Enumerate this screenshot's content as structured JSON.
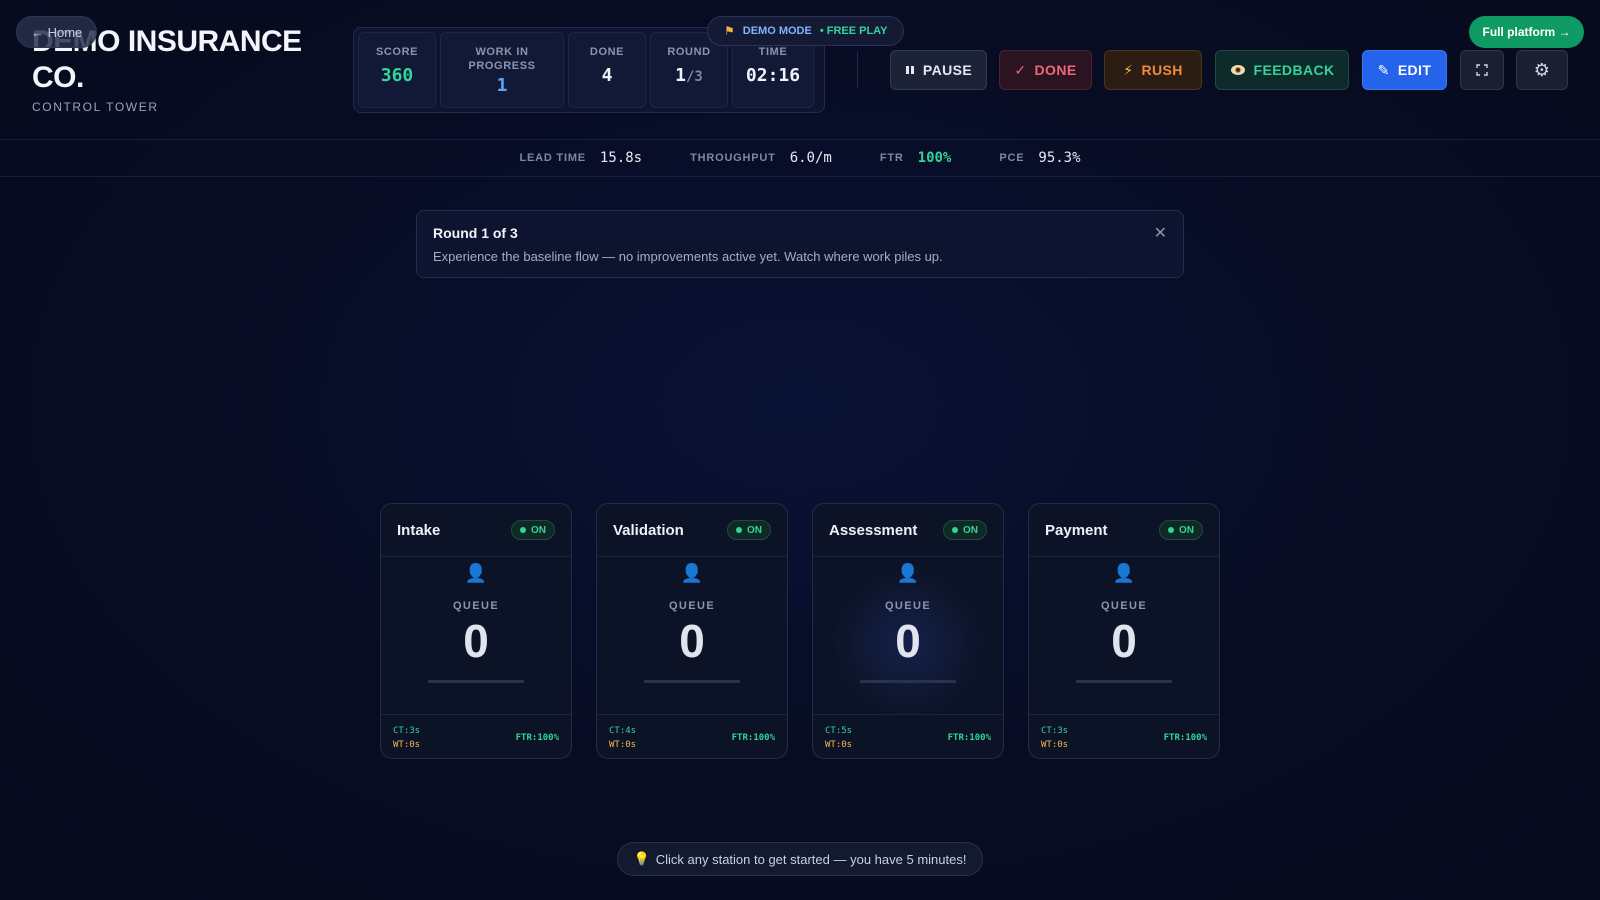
{
  "nav": {
    "home_label": "← Home"
  },
  "brand": {
    "title": "DEMO INSURANCE CO.",
    "subtitle": "CONTROL TOWER"
  },
  "demo_pill": {
    "mode": "DEMO MODE",
    "free": "• FREE PLAY"
  },
  "stats": {
    "score_label": "SCORE",
    "score": "360",
    "wip_label": "WORK IN PROGRESS",
    "wip": "1",
    "done_label": "DONE",
    "done": "4",
    "round_label": "ROUND",
    "round": "1",
    "round_total": "/3",
    "time_label": "TIME",
    "time": "02:16"
  },
  "toolbar": {
    "pause": "PAUSE",
    "done": "DONE",
    "rush": "RUSH",
    "feedback": "FEEDBACK",
    "edit": "EDIT",
    "full_platform": "Full platform →"
  },
  "metrics": [
    {
      "label": "LEAD TIME",
      "value": "15.8s"
    },
    {
      "label": "THROUGHPUT",
      "value": "6.0/m"
    },
    {
      "label": "FTR",
      "value": "100%"
    },
    {
      "label": "PCE",
      "value": "95.3%"
    }
  ],
  "banner": {
    "title": "Round 1 of 3",
    "text": "Experience the baseline flow — no improvements active yet. Watch where work piles up."
  },
  "stations": [
    {
      "name": "Intake",
      "status": "ON",
      "queue_label": "QUEUE",
      "queue": "0",
      "ct": "CT:3s",
      "wt": "WT:0s",
      "ftr": "FTR:100%"
    },
    {
      "name": "Validation",
      "status": "ON",
      "queue_label": "QUEUE",
      "queue": "0",
      "ct": "CT:4s",
      "wt": "WT:0s",
      "ftr": "FTR:100%"
    },
    {
      "name": "Assessment",
      "status": "ON",
      "queue_label": "QUEUE",
      "queue": "0",
      "ct": "CT:5s",
      "wt": "WT:0s",
      "ftr": "FTR:100%"
    },
    {
      "name": "Payment",
      "status": "ON",
      "queue_label": "QUEUE",
      "queue": "0",
      "ct": "CT:3s",
      "wt": "WT:0s",
      "ftr": "FTR:100%"
    }
  ],
  "hint": {
    "text": "Click any station to get started — you have 5 minutes!"
  },
  "colors": {
    "accent_green": "#34d399",
    "accent_blue": "#2563eb",
    "danger": "#f0667a",
    "warning": "#f08a3c"
  }
}
